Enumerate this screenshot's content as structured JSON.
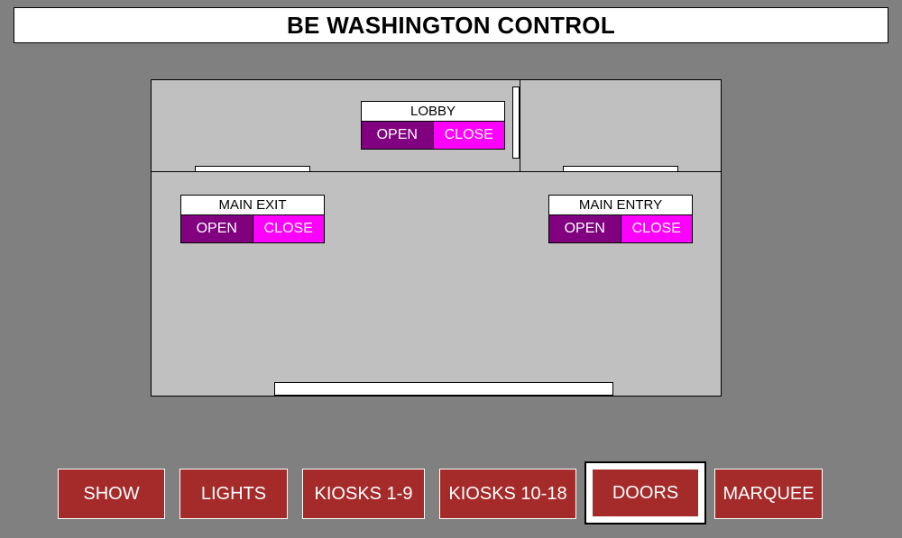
{
  "title": "BE WASHINGTON CONTROL",
  "doors": {
    "lobby": {
      "label": "LOBBY",
      "open": "OPEN",
      "close": "CLOSE"
    },
    "main_exit": {
      "label": "MAIN EXIT",
      "open": "OPEN",
      "close": "CLOSE"
    },
    "main_entry": {
      "label": "MAIN ENTRY",
      "open": "OPEN",
      "close": "CLOSE"
    }
  },
  "nav": {
    "show": "SHOW",
    "lights": "LIGHTS",
    "kiosks_1_9": "KIOSKS 1-9",
    "kiosks_10_18": "KIOSKS 10-18",
    "doors": "DOORS",
    "marquee": "MARQUEE",
    "active": "DOORS"
  },
  "colors": {
    "background": "#808080",
    "floor": "#c0c0c0",
    "open_button": "#800080",
    "close_button": "#ff00ff",
    "nav_button": "#a52a2a"
  }
}
